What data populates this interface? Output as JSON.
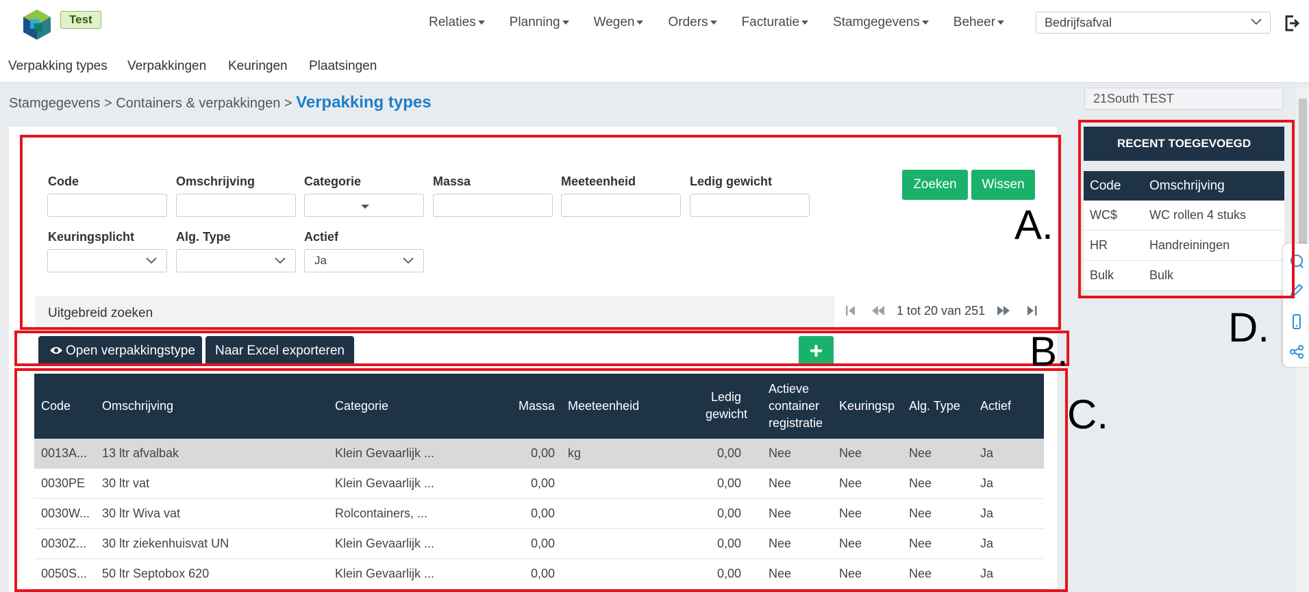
{
  "header": {
    "badge": "Test",
    "nav": [
      "Relaties",
      "Planning",
      "Wegen",
      "Orders",
      "Facturatie",
      "Stamgegevens",
      "Beheer"
    ],
    "company_select": "Bedrijfsafval"
  },
  "subnav": [
    "Verpakking types",
    "Verpakkingen",
    "Keuringen",
    "Plaatsingen"
  ],
  "breadcrumb": {
    "path": "Stamgegevens > Containers & verpakkingen >",
    "current": "Verpakking types"
  },
  "filters": {
    "code": "Code",
    "omschrijving": "Omschrijving",
    "categorie": "Categorie",
    "massa": "Massa",
    "meeteenheid": "Meeteenheid",
    "ledig_gewicht": "Ledig gewicht",
    "keuringsplicht": "Keuringsplicht",
    "alg_type": "Alg. Type",
    "actief": "Actief",
    "actief_value": "Ja",
    "search_button": "Zoeken",
    "clear_button": "Wissen",
    "advanced": "Uitgebreid zoeken",
    "pagination": "1 tot 20 van 251"
  },
  "toolbar": {
    "open_button": "Open verpakkingstype",
    "export_button": "Naar Excel exporteren",
    "add_button": "+"
  },
  "table": {
    "headers": {
      "code": "Code",
      "omschrijving": "Omschrijving",
      "categorie": "Categorie",
      "massa": "Massa",
      "meeteenheid": "Meeteenheid",
      "ledig_line1": "Ledig",
      "ledig_line2": "gewicht",
      "actieve_line1": "Actieve",
      "actieve_line2": "container",
      "actieve_line3": "registratie",
      "keuringsp": "Keuringsp",
      "alg_type": "Alg. Type",
      "actief": "Actief"
    },
    "rows": [
      {
        "code": "0013A...",
        "omschrijving": "13 ltr afvalbak",
        "categorie": "Klein Gevaarlijk ...",
        "massa": "0,00",
        "meeteenheid": "kg",
        "ledig_gewicht": "0,00",
        "actieve": "Nee",
        "keuringsp": "Nee",
        "alg_type": "Nee",
        "actief": "Ja"
      },
      {
        "code": "0030PE",
        "omschrijving": "30 ltr vat",
        "categorie": "Klein Gevaarlijk ...",
        "massa": "0,00",
        "meeteenheid": "",
        "ledig_gewicht": "0,00",
        "actieve": "Nee",
        "keuringsp": "Nee",
        "alg_type": "Nee",
        "actief": "Ja"
      },
      {
        "code": "0030W...",
        "omschrijving": "30 ltr Wiva vat",
        "categorie": "Rolcontainers, ...",
        "massa": "0,00",
        "meeteenheid": "",
        "ledig_gewicht": "0,00",
        "actieve": "Nee",
        "keuringsp": "Nee",
        "alg_type": "Nee",
        "actief": "Ja"
      },
      {
        "code": "0030Z...",
        "omschrijving": "30 ltr ziekenhuisvat UN",
        "categorie": "Klein Gevaarlijk ...",
        "massa": "0,00",
        "meeteenheid": "",
        "ledig_gewicht": "0,00",
        "actieve": "Nee",
        "keuringsp": "Nee",
        "alg_type": "Nee",
        "actief": "Ja"
      },
      {
        "code": "0050S...",
        "omschrijving": "50 ltr Septobox 620",
        "categorie": "Klein Gevaarlijk ...",
        "massa": "0,00",
        "meeteenheid": "",
        "ledig_gewicht": "0,00",
        "actieve": "Nee",
        "keuringsp": "Nee",
        "alg_type": "Nee",
        "actief": "Ja"
      }
    ]
  },
  "sidebar": {
    "company": "21South TEST",
    "recent_title": "RECENT TOEGEVOEGD",
    "col_code": "Code",
    "col_omschrijving": "Omschrijving",
    "rows": [
      {
        "code": "WC$",
        "omschrijving": "WC rollen 4 stuks"
      },
      {
        "code": "HR",
        "omschrijving": "Handreiningen"
      },
      {
        "code": "Bulk",
        "omschrijving": "Bulk"
      }
    ]
  },
  "annotations": [
    "A.",
    "B.",
    "C.",
    "D."
  ],
  "colors": {
    "navy": "#1f3347",
    "green": "#1ab26b",
    "title_blue": "#1e7ec8",
    "annotation_red": "#e4141c"
  },
  "icons": [
    "app-logo-icon",
    "logout-icon",
    "chevron-down-icon",
    "eye-icon",
    "plus-icon",
    "first-page-icon",
    "prev-page-icon",
    "next-page-icon",
    "last-page-icon",
    "chat-icon",
    "pen-icon",
    "mobile-icon",
    "share-icon"
  ]
}
